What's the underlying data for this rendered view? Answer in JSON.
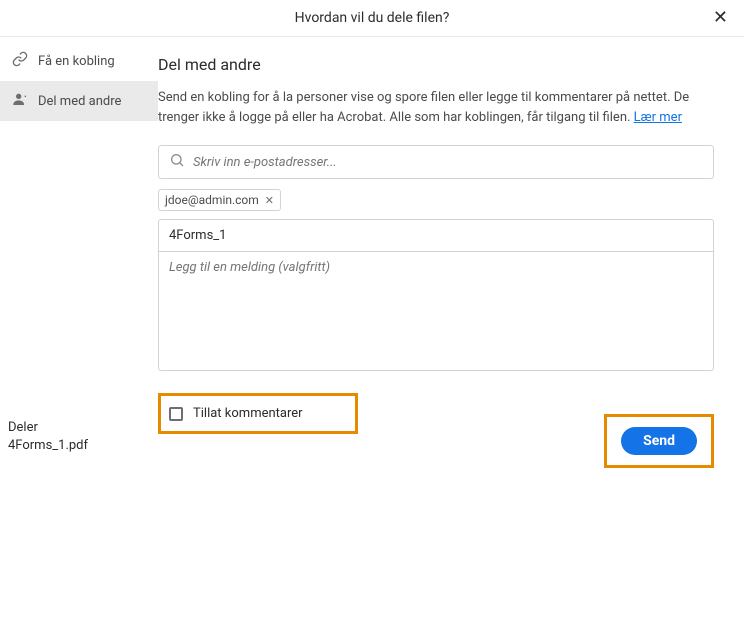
{
  "header": {
    "title": "Hvordan vil du dele filen?"
  },
  "sidebar": {
    "items": [
      {
        "label": "Få en kobling"
      },
      {
        "label": "Del med andre"
      }
    ],
    "footer": {
      "line1": "Deler",
      "line2": "4Forms_1.pdf"
    }
  },
  "main": {
    "title": "Del med andre",
    "description_part1": "Send en kobling for å la personer vise og spore filen eller legge til kommentarer på nettet. De trenger ikke å logge på eller ha Acrobat. Alle som har koblingen, får tilgang til filen. ",
    "learn_more": "Lær mer",
    "email_placeholder": "Skriv inn e-postadresser...",
    "chip_email": "jdoe@admin.com",
    "subject_value": "4Forms_1",
    "message_placeholder": "Legg til en melding (valgfritt)",
    "allow_comments_label": "Tillat kommentarer",
    "send_label": "Send"
  }
}
